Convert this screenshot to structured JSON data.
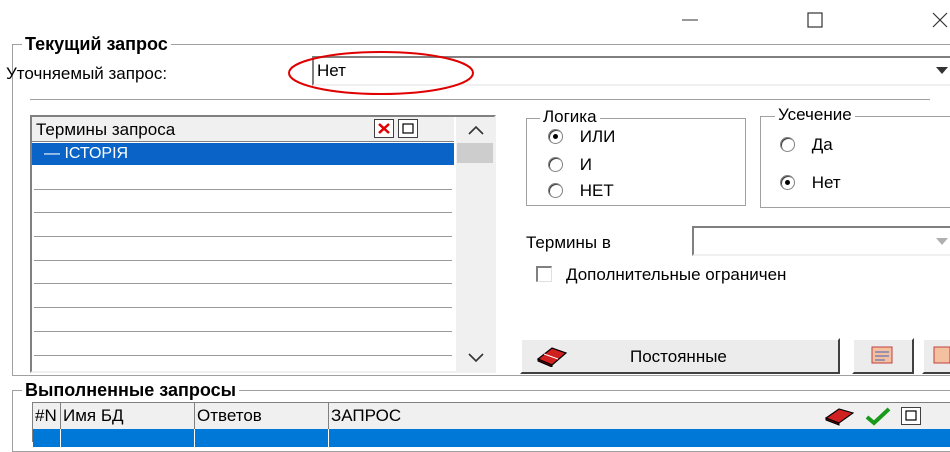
{
  "window": {
    "minimize_icon": "minimize-icon",
    "maximize_icon": "maximize-icon",
    "close_icon": "close-icon"
  },
  "current_query": {
    "title": "Текущий запрос",
    "refine_label": "Уточняемый запрос:",
    "refine_value": "Нет",
    "highlight_color": "#e00000"
  },
  "terms": {
    "header": "Термины запроса",
    "items": [
      "— ІСТОРІЯ"
    ],
    "selection_color": "#0a64c8"
  },
  "logic": {
    "title": "Логика",
    "options": [
      {
        "label": "ИЛИ",
        "checked": true
      },
      {
        "label": "И",
        "checked": false
      },
      {
        "label": "НЕТ",
        "checked": false
      }
    ]
  },
  "truncation": {
    "title": "Усечение",
    "options": [
      {
        "label": "Да",
        "checked": false
      },
      {
        "label": "Нет",
        "checked": true
      }
    ]
  },
  "terms_in": {
    "label": "Термины в",
    "value": ""
  },
  "extra": {
    "label": "Дополнительные ограничен"
  },
  "permanent_button": {
    "label": "Постоянные"
  },
  "executed": {
    "title": "Выполненные запросы",
    "columns": [
      "#N",
      "Имя БД",
      "Ответов",
      "ЗАПРОС"
    ],
    "selection_color": "#0078d7"
  }
}
